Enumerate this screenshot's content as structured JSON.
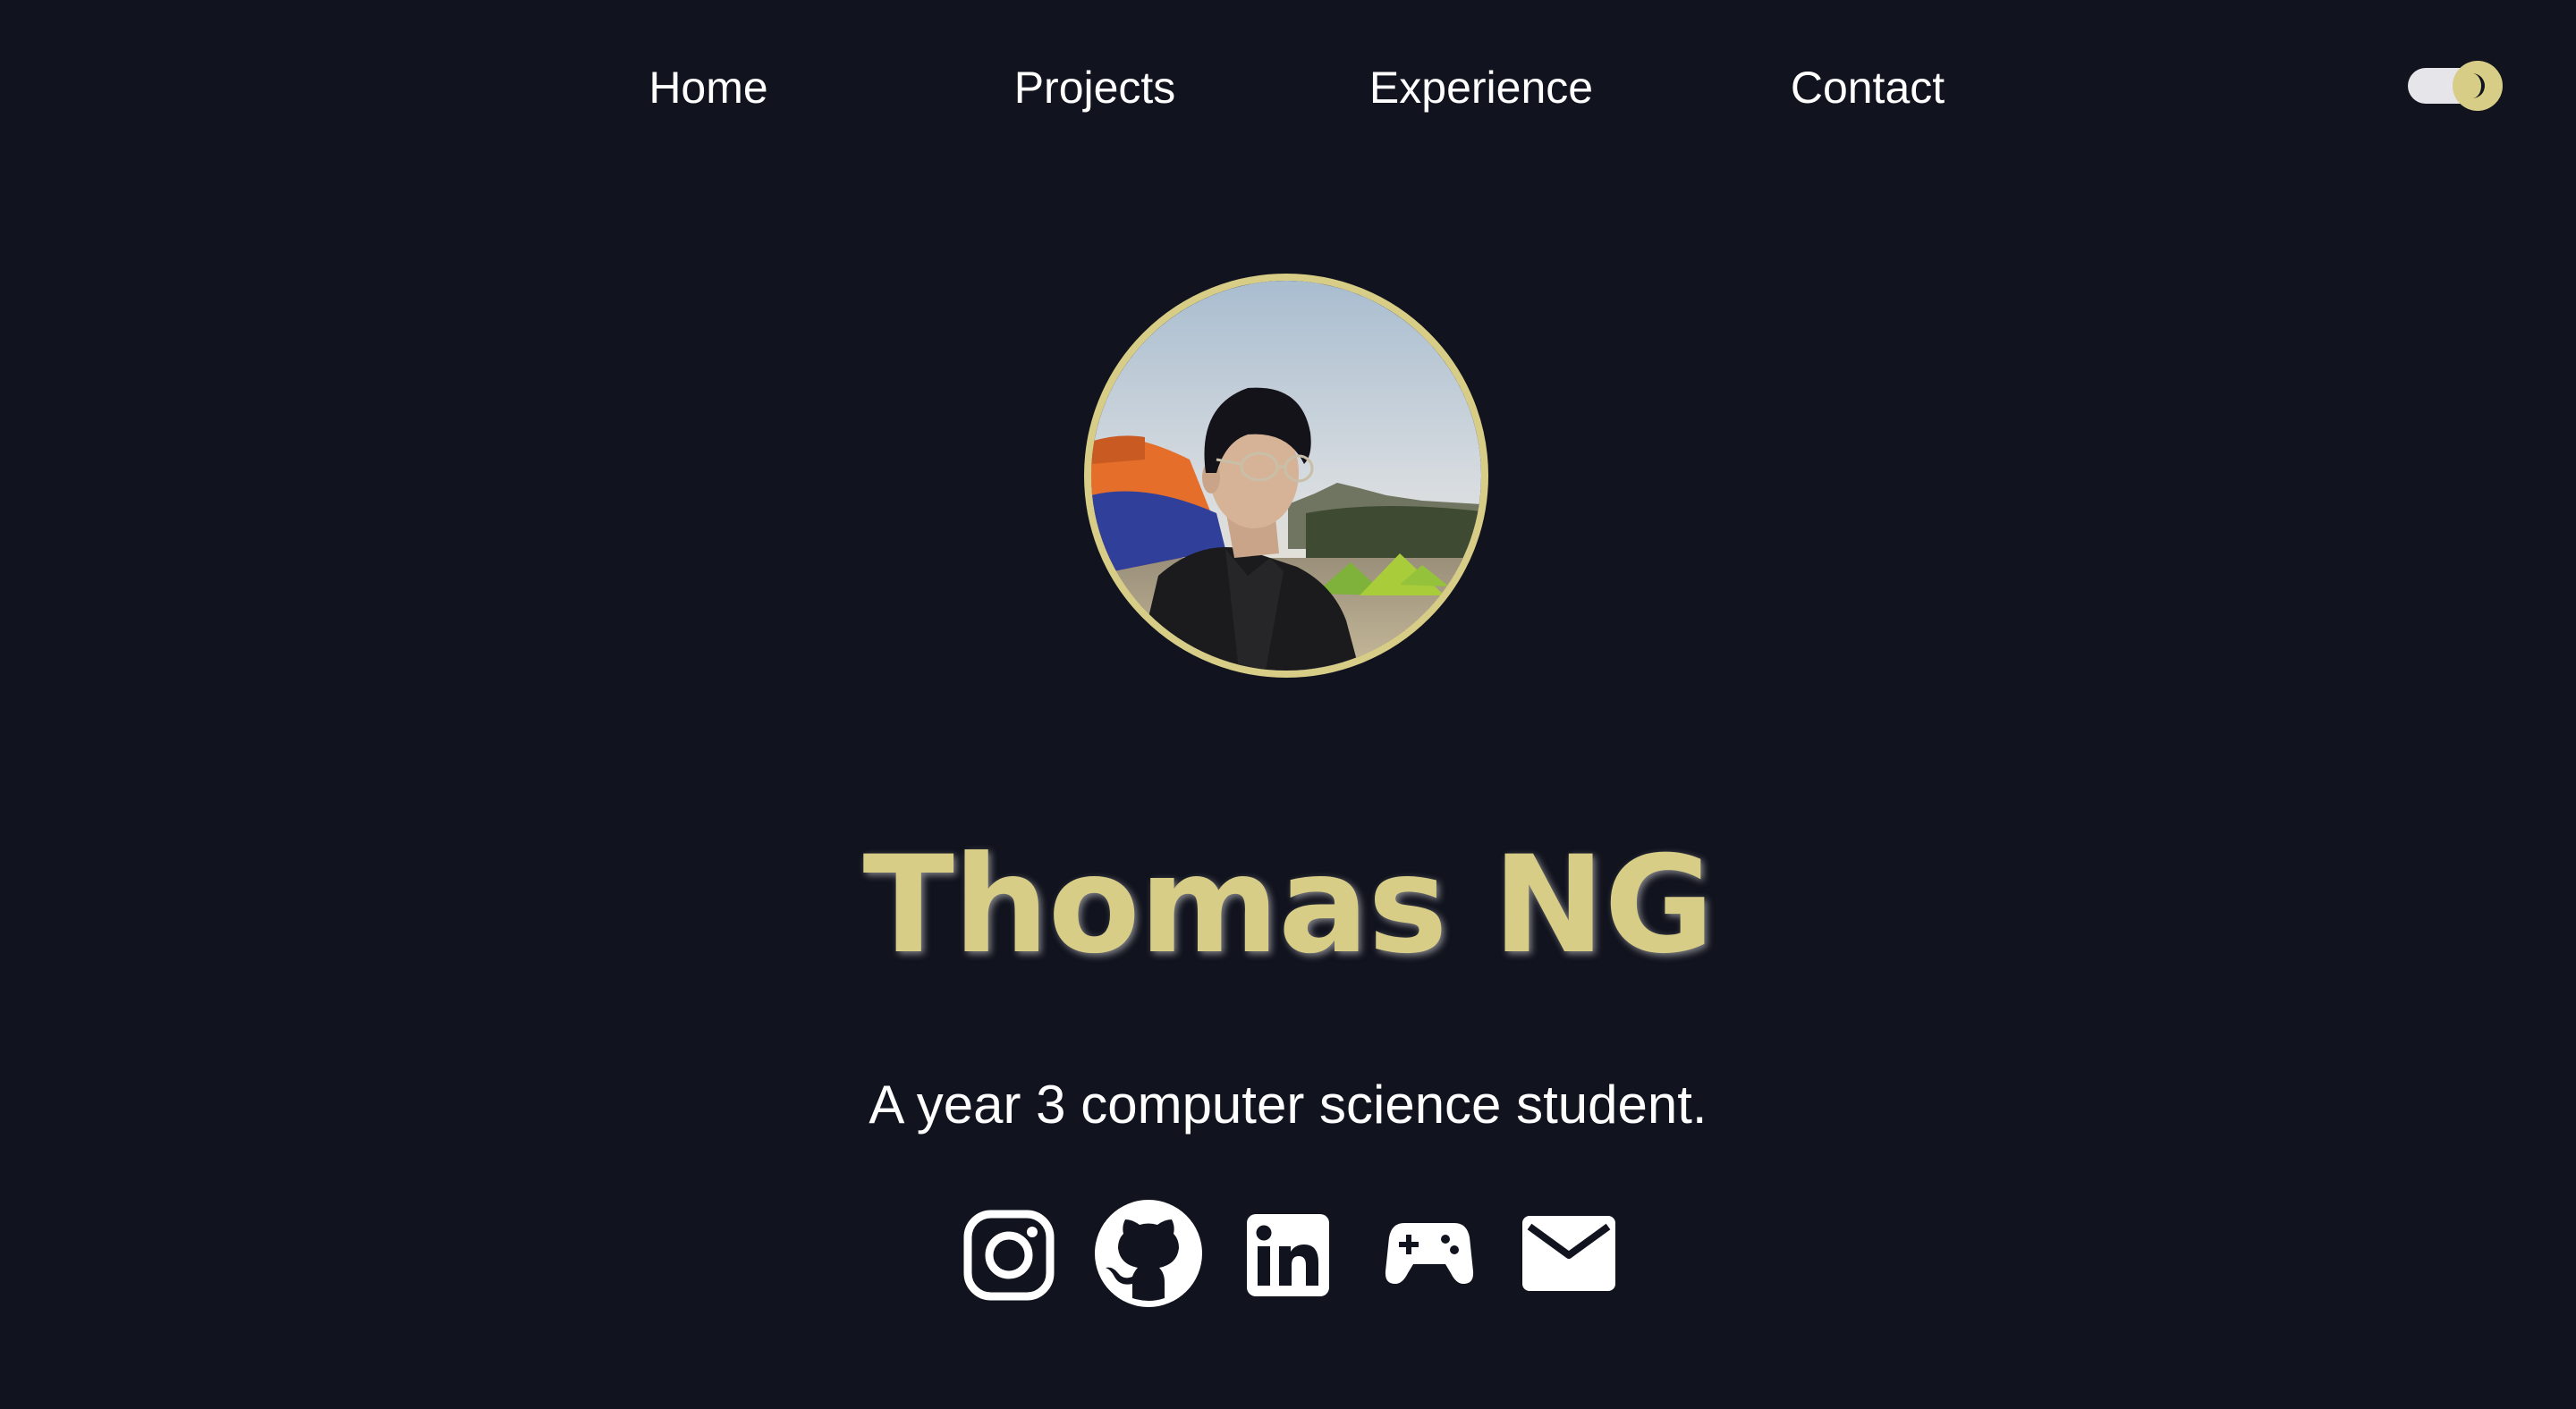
{
  "nav": {
    "items": [
      {
        "label": "Home"
      },
      {
        "label": "Projects"
      },
      {
        "label": "Experience"
      },
      {
        "label": "Contact"
      }
    ]
  },
  "theme_toggle": {
    "state": "dark",
    "icon": "moon-icon",
    "accent_color": "#d7cd87",
    "track_color": "#e6e6ea"
  },
  "profile": {
    "name": "Thomas NG",
    "tagline": "A year 3 computer science student.",
    "avatar_icon": "profile-photo"
  },
  "social": {
    "links": [
      {
        "icon": "instagram-icon"
      },
      {
        "icon": "github-icon"
      },
      {
        "icon": "linkedin-icon"
      },
      {
        "icon": "gamepad-icon"
      },
      {
        "icon": "mail-icon"
      }
    ]
  },
  "colors": {
    "background": "#11131e",
    "accent": "#d7cd87",
    "text": "#ffffff"
  }
}
